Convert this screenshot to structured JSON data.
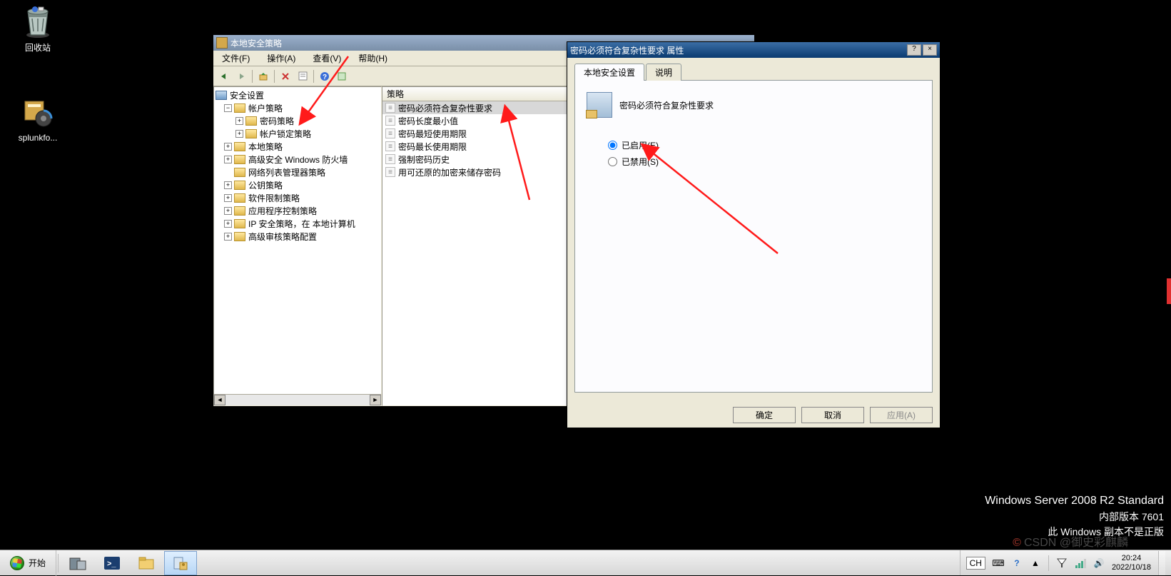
{
  "desktop": {
    "recycle_bin": "回收站",
    "splunk": "splunkfo..."
  },
  "main_window": {
    "title": "本地安全策略",
    "menu": {
      "file": "文件(F)",
      "action": "操作(A)",
      "view": "查看(V)",
      "help": "帮助(H)"
    },
    "tree": {
      "root": "安全设置",
      "account_policy": "帐户策略",
      "password_policy": "密码策略",
      "lockout_policy": "帐户锁定策略",
      "local_policy": "本地策略",
      "firewall": "高级安全 Windows 防火墙",
      "netlist": "网络列表管理器策略",
      "pubkey": "公钥策略",
      "software": "软件限制策略",
      "appctrl": "应用程序控制策略",
      "ipsec": "IP 安全策略，在 本地计算机",
      "audit": "高级审核策略配置"
    },
    "list": {
      "header": "策略",
      "items": [
        "密码必须符合复杂性要求",
        "密码长度最小值",
        "密码最短使用期限",
        "密码最长使用期限",
        "强制密码历史",
        "用可还原的加密来储存密码"
      ]
    }
  },
  "dialog": {
    "title": "密码必须符合复杂性要求 属性",
    "tab_local": "本地安全设置",
    "tab_explain": "说明",
    "heading": "密码必须符合复杂性要求",
    "enabled": "已启用(E)",
    "disabled": "已禁用(S)",
    "ok": "确定",
    "cancel": "取消",
    "apply": "应用(A)"
  },
  "watermark": {
    "line1": "Windows Server 2008 R2 Standard",
    "line2": "内部版本 7601",
    "line3": "此 Windows 副本不是正版"
  },
  "taskbar": {
    "start": "开始",
    "lang": "CH",
    "time": "20:24",
    "date": "2022/10/18"
  },
  "csdn": "CSDN @御史彩麒麟"
}
